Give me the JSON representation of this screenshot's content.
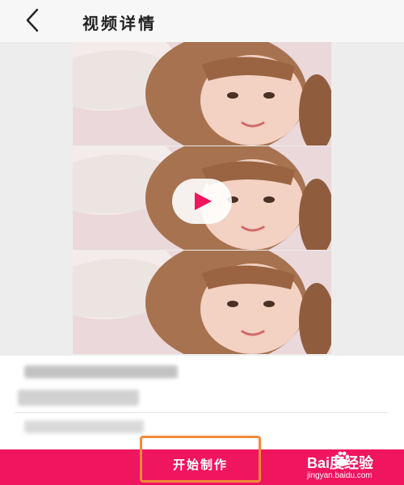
{
  "header": {
    "title": "视频详情"
  },
  "main": {
    "play_label": ""
  },
  "footer": {
    "start_label": "开始制作"
  },
  "watermark": {
    "logo_text": "Bai度经验",
    "site": "jingyan.baidu.com"
  },
  "colors": {
    "accent": "#f0155f",
    "highlight_border": "#f08a3a",
    "play_triangle": "#f0155f"
  },
  "icons": {
    "back": "chevron-left-icon",
    "play": "play-icon",
    "paw": "paw-icon"
  }
}
